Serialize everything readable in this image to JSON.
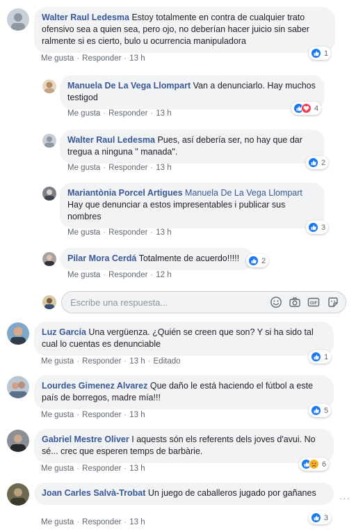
{
  "labels": {
    "like": "Me gusta",
    "reply": "Responder",
    "edited": "Editado"
  },
  "reply_box": {
    "placeholder": "Escribe una respuesta..."
  },
  "comments": [
    {
      "author": "Walter Raul Ledesma",
      "text": "Estoy totalmente en contra de cualquier trato ofensivo sea a quien sea, pero ojo, no deberían hacer juicio sin saber ralmente si es cierto, bulo u ocurrencia manipuladora",
      "time": "13 h",
      "reactions": "1",
      "reaction_types": [
        "like"
      ]
    },
    {
      "author": "Manuela De La Vega Llompart",
      "text": "Van a denunciarlo. Hay muchos testigod",
      "time": "13 h",
      "reactions": "4",
      "reaction_types": [
        "like",
        "love"
      ]
    },
    {
      "author": "Walter Raul Ledesma",
      "text": "Pues, así debería ser, no hay que dar tregua a ninguna \" manada\".",
      "time": "13 h",
      "reactions": "2",
      "reaction_types": [
        "like"
      ]
    },
    {
      "author": "Mariantònia Porcel Artigues",
      "mention": "Manuela De La Vega Llompart",
      "text": "Hay que denunciar a estos impresentables i publicar sus nombres",
      "time": "13 h",
      "reactions": "3",
      "reaction_types": [
        "like"
      ]
    },
    {
      "author": "Pilar Mora Cerdá",
      "text": "Totalmente de acuerdo!!!!!",
      "time": "12 h",
      "reactions": "2",
      "reaction_types": [
        "like"
      ]
    },
    {
      "author": "Luz García",
      "text": "Una vergüenza. ¿Quién se creen que son? Y si ha sido tal cual lo cuentas es denunciable",
      "time": "13 h",
      "reactions": "1",
      "reaction_types": [
        "like"
      ],
      "edited": true
    },
    {
      "author": "Lourdes Gimenez Alvarez",
      "text": "Que daño le está haciendo el fútbol a este país de borregos, madre mía!!!",
      "time": "13 h",
      "reactions": "5",
      "reaction_types": [
        "like"
      ]
    },
    {
      "author": "Gabriel Mestre Oliver",
      "text": "I aquests són els referents dels joves d'avui. No sé... crec que esperen temps de barbàrie.",
      "time": "13 h",
      "reactions": "6",
      "reaction_types": [
        "like",
        "sad"
      ]
    },
    {
      "author": "Joan Carles Salvà-Trobat",
      "text": "Un juego de caballeros jugado por gañanes",
      "time": "13 h",
      "reactions": "3",
      "reaction_types": [
        "like"
      ]
    }
  ],
  "colors": {
    "link": "#385898",
    "bubble": "#f2f3f5",
    "like": "#1877f2",
    "love": "#f33e58",
    "sad": "#f7b125",
    "meta": "#606770"
  }
}
